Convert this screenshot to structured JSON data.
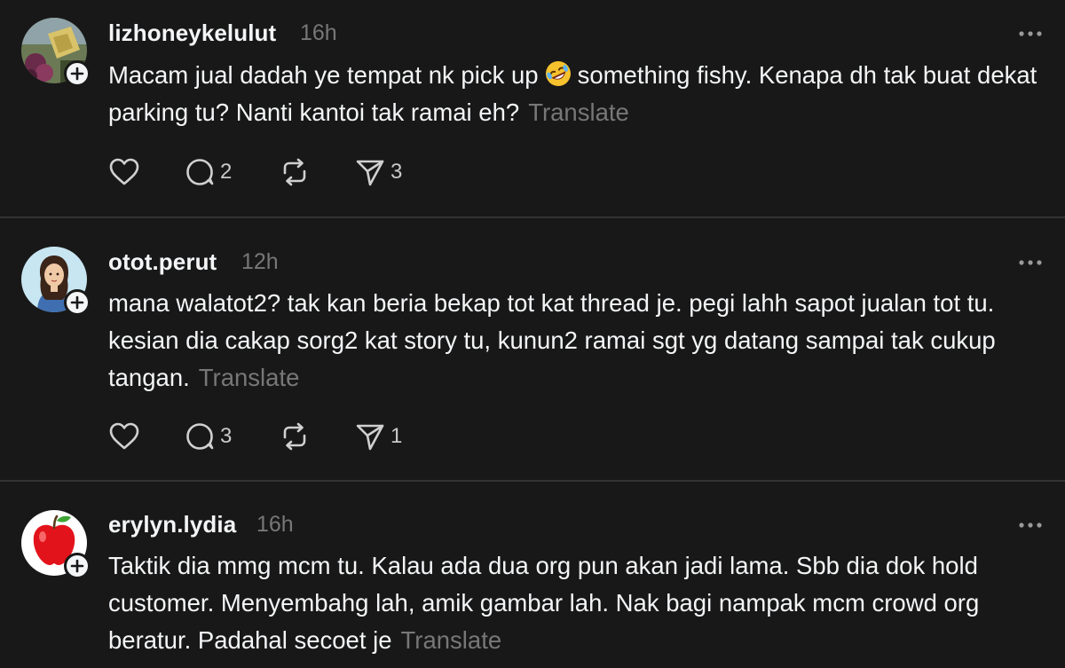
{
  "posts": [
    {
      "username": "lizhoneykelulut",
      "time": "16h",
      "text_before_emoji": "Macam jual dadah ye tempat nk pick up",
      "text_after_emoji": "something fishy. Kenapa dh tak buat dekat parking tu? Nanti kantoi tak ramai eh?",
      "emoji": "rolling-on-floor-laughing-emoji",
      "translate_label": "Translate",
      "likes": "",
      "replies": "2",
      "reposts": "",
      "shares": "3"
    },
    {
      "username": "otot.perut",
      "time": "12h",
      "text": "mana walatot2? tak kan beria bekap tot kat thread je. pegi lahh sapot jualan tot tu. kesian dia cakap sorg2 kat story tu, kunun2 ramai sgt yg datang sampai tak cukup tangan.",
      "translate_label": "Translate",
      "likes": "",
      "replies": "3",
      "reposts": "",
      "shares": "1"
    },
    {
      "username": "erylyn.lydia",
      "time": "16h",
      "text": "Taktik dia mmg mcm tu. Kalau ada dua org pun akan jadi lama. Sbb dia dok hold customer. Menyembahg lah, amik gambar lah. Nak bagi nampak mcm crowd org beratur. Padahal secoet je",
      "translate_label": "Translate"
    }
  ],
  "icons": {
    "like": "heart-icon",
    "reply": "comment-icon",
    "repost": "repost-icon",
    "share": "send-icon",
    "follow": "plus-icon",
    "more": "more-icon"
  },
  "colors": {
    "background": "#181818",
    "text": "#f3f5f7",
    "secondary": "#777777",
    "divider": "#333333"
  }
}
